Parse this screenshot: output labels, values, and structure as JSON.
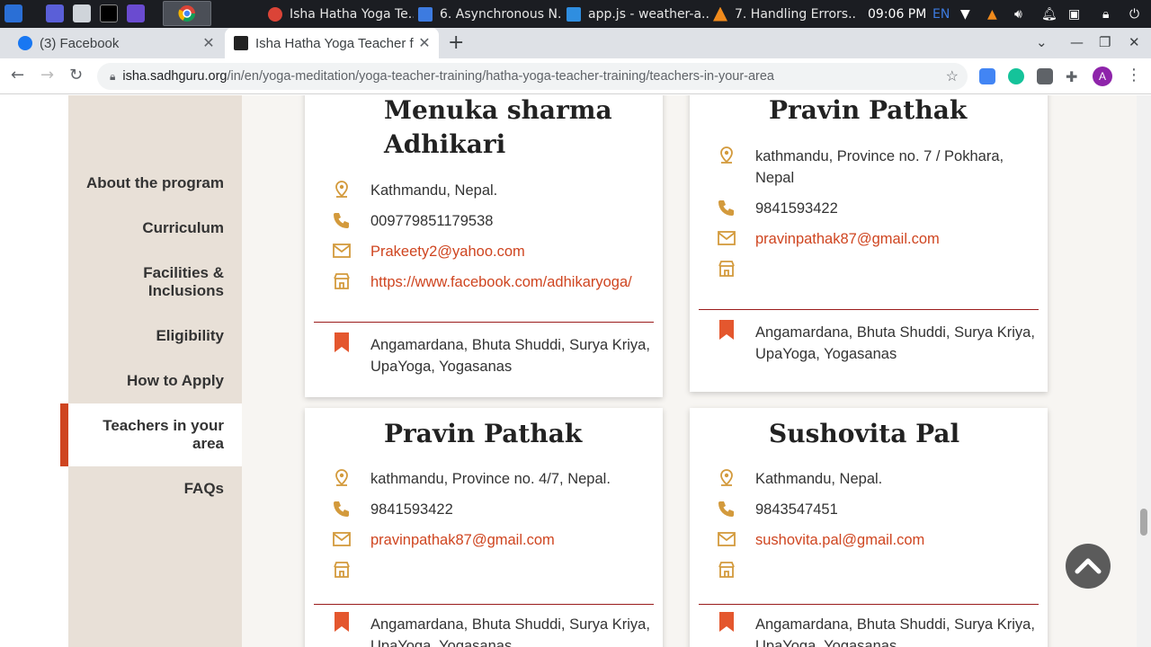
{
  "taskbar": {
    "tasks": [
      {
        "label": "Isha Hatha Yoga Te..."
      },
      {
        "label": "6. Asynchronous N..."
      },
      {
        "label": "app.js - weather-a..."
      },
      {
        "label": "7. Handling Errors...."
      }
    ],
    "clock": "09:06 PM",
    "lang": "EN"
  },
  "browser": {
    "tabs": [
      {
        "title": "(3) Facebook"
      },
      {
        "title": "Isha Hatha Yoga Teacher f"
      }
    ],
    "url_host": "isha.sadhguru.org",
    "url_path": "/in/en/yoga-meditation/yoga-teacher-training/hatha-yoga-teacher-training/teachers-in-your-area",
    "avatar_letter": "A"
  },
  "sidenav": {
    "items": [
      {
        "label": "About the program"
      },
      {
        "label": "Curriculum"
      },
      {
        "label": "Facilities & Inclusions"
      },
      {
        "label": "Eligibility"
      },
      {
        "label": "How to Apply"
      },
      {
        "label": "Teachers in your area"
      },
      {
        "label": "FAQs"
      }
    ],
    "active_index": 5
  },
  "teachers": [
    {
      "name": "Menuka sharma Adhikari",
      "location": "Kathmandu, Nepal.",
      "phone": "009779851179538",
      "email": "Prakeety2@yahoo.com",
      "website": "https://www.facebook.com/adhikaryoga/",
      "programs": "Angamardana, Bhuta Shuddi, Surya Kriya, UpaYoga, Yogasanas"
    },
    {
      "name": "Pravin Pathak",
      "location": "kathmandu, Province no. 7 / Pokhara, Nepal",
      "phone": "9841593422",
      "email": "pravinpathak87@gmail.com",
      "website": "",
      "programs": "Angamardana, Bhuta Shuddi, Surya Kriya, UpaYoga, Yogasanas"
    },
    {
      "name": "Pravin Pathak",
      "location": "kathmandu, Province no. 4/7, Nepal.",
      "phone": "9841593422",
      "email": "pravinpathak87@gmail.com",
      "website": "",
      "programs": "Angamardana, Bhuta Shuddi, Surya Kriya, UpaYoga, Yogasanas"
    },
    {
      "name": "Sushovita Pal",
      "location": "Kathmandu, Nepal.",
      "phone": "9843547451",
      "email": "sushovita.pal@gmail.com",
      "website": "",
      "programs": "Angamardana, Bhuta Shuddi, Surya Kriya, UpaYoga, Yogasanas"
    }
  ],
  "colors": {
    "accent": "#cf4520",
    "icon_gold": "#d39a3c",
    "sidenav_bg": "#e8e0d7",
    "divider": "#9a1b1b"
  },
  "icons": {
    "location": "location-pin-icon",
    "phone": "phone-icon",
    "email": "mail-icon",
    "website": "store-icon",
    "programs": "bookmark-icon"
  }
}
